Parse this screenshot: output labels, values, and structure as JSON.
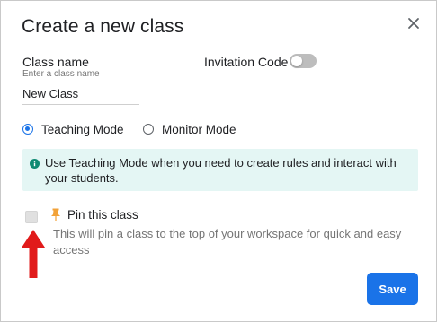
{
  "dialog": {
    "title": "Create a new class",
    "close_icon": "close-icon"
  },
  "class_name": {
    "label": "Class name",
    "hint": "Enter a class name",
    "value": "New Class"
  },
  "invitation": {
    "label": "Invitation Code",
    "enabled": false
  },
  "mode": {
    "options": [
      {
        "label": "Teaching Mode",
        "selected": true
      },
      {
        "label": "Monitor Mode",
        "selected": false
      }
    ]
  },
  "info": {
    "icon": "info-icon",
    "text": "Use Teaching Mode when you need to create rules and interact with your students."
  },
  "pin": {
    "checked": false,
    "icon": "pin-icon",
    "label": "Pin this class",
    "description": "This will pin a class to the top of your workspace for quick and easy access"
  },
  "annotation": {
    "arrow_icon": "red-up-arrow-icon",
    "color": "#e11b1b"
  },
  "footer": {
    "save_label": "Save"
  },
  "colors": {
    "accent": "#1a73e8",
    "info_bg": "#e4f6f4",
    "info_icon": "#0f8a73",
    "pin": "#f2a238",
    "toggle_off": "#bdbdbd"
  }
}
